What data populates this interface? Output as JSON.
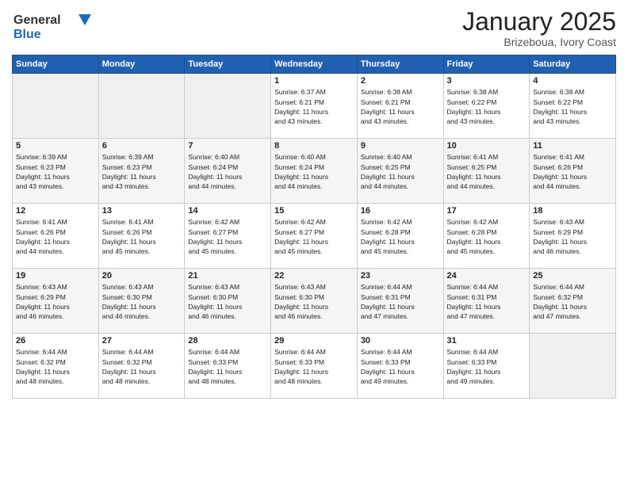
{
  "header": {
    "title": "January 2025",
    "location": "Brizeboua, Ivory Coast"
  },
  "calendar": {
    "days": [
      "Sunday",
      "Monday",
      "Tuesday",
      "Wednesday",
      "Thursday",
      "Friday",
      "Saturday"
    ],
    "weeks": [
      [
        {
          "num": "",
          "info": ""
        },
        {
          "num": "",
          "info": ""
        },
        {
          "num": "",
          "info": ""
        },
        {
          "num": "1",
          "info": "Sunrise: 6:37 AM\nSunset: 6:21 PM\nDaylight: 11 hours\nand 43 minutes."
        },
        {
          "num": "2",
          "info": "Sunrise: 6:38 AM\nSunset: 6:21 PM\nDaylight: 11 hours\nand 43 minutes."
        },
        {
          "num": "3",
          "info": "Sunrise: 6:38 AM\nSunset: 6:22 PM\nDaylight: 11 hours\nand 43 minutes."
        },
        {
          "num": "4",
          "info": "Sunrise: 6:38 AM\nSunset: 6:22 PM\nDaylight: 11 hours\nand 43 minutes."
        }
      ],
      [
        {
          "num": "5",
          "info": "Sunrise: 6:39 AM\nSunset: 6:23 PM\nDaylight: 11 hours\nand 43 minutes."
        },
        {
          "num": "6",
          "info": "Sunrise: 6:39 AM\nSunset: 6:23 PM\nDaylight: 11 hours\nand 43 minutes."
        },
        {
          "num": "7",
          "info": "Sunrise: 6:40 AM\nSunset: 6:24 PM\nDaylight: 11 hours\nand 44 minutes."
        },
        {
          "num": "8",
          "info": "Sunrise: 6:40 AM\nSunset: 6:24 PM\nDaylight: 11 hours\nand 44 minutes."
        },
        {
          "num": "9",
          "info": "Sunrise: 6:40 AM\nSunset: 6:25 PM\nDaylight: 11 hours\nand 44 minutes."
        },
        {
          "num": "10",
          "info": "Sunrise: 6:41 AM\nSunset: 6:25 PM\nDaylight: 11 hours\nand 44 minutes."
        },
        {
          "num": "11",
          "info": "Sunrise: 6:41 AM\nSunset: 6:26 PM\nDaylight: 11 hours\nand 44 minutes."
        }
      ],
      [
        {
          "num": "12",
          "info": "Sunrise: 6:41 AM\nSunset: 6:26 PM\nDaylight: 11 hours\nand 44 minutes."
        },
        {
          "num": "13",
          "info": "Sunrise: 6:41 AM\nSunset: 6:26 PM\nDaylight: 11 hours\nand 45 minutes."
        },
        {
          "num": "14",
          "info": "Sunrise: 6:42 AM\nSunset: 6:27 PM\nDaylight: 11 hours\nand 45 minutes."
        },
        {
          "num": "15",
          "info": "Sunrise: 6:42 AM\nSunset: 6:27 PM\nDaylight: 11 hours\nand 45 minutes."
        },
        {
          "num": "16",
          "info": "Sunrise: 6:42 AM\nSunset: 6:28 PM\nDaylight: 11 hours\nand 45 minutes."
        },
        {
          "num": "17",
          "info": "Sunrise: 6:42 AM\nSunset: 6:28 PM\nDaylight: 11 hours\nand 45 minutes."
        },
        {
          "num": "18",
          "info": "Sunrise: 6:43 AM\nSunset: 6:29 PM\nDaylight: 11 hours\nand 46 minutes."
        }
      ],
      [
        {
          "num": "19",
          "info": "Sunrise: 6:43 AM\nSunset: 6:29 PM\nDaylight: 11 hours\nand 46 minutes."
        },
        {
          "num": "20",
          "info": "Sunrise: 6:43 AM\nSunset: 6:30 PM\nDaylight: 11 hours\nand 46 minutes."
        },
        {
          "num": "21",
          "info": "Sunrise: 6:43 AM\nSunset: 6:30 PM\nDaylight: 11 hours\nand 46 minutes."
        },
        {
          "num": "22",
          "info": "Sunrise: 6:43 AM\nSunset: 6:30 PM\nDaylight: 11 hours\nand 46 minutes."
        },
        {
          "num": "23",
          "info": "Sunrise: 6:44 AM\nSunset: 6:31 PM\nDaylight: 11 hours\nand 47 minutes."
        },
        {
          "num": "24",
          "info": "Sunrise: 6:44 AM\nSunset: 6:31 PM\nDaylight: 11 hours\nand 47 minutes."
        },
        {
          "num": "25",
          "info": "Sunrise: 6:44 AM\nSunset: 6:32 PM\nDaylight: 11 hours\nand 47 minutes."
        }
      ],
      [
        {
          "num": "26",
          "info": "Sunrise: 6:44 AM\nSunset: 6:32 PM\nDaylight: 11 hours\nand 48 minutes."
        },
        {
          "num": "27",
          "info": "Sunrise: 6:44 AM\nSunset: 6:32 PM\nDaylight: 11 hours\nand 48 minutes."
        },
        {
          "num": "28",
          "info": "Sunrise: 6:44 AM\nSunset: 6:33 PM\nDaylight: 11 hours\nand 48 minutes."
        },
        {
          "num": "29",
          "info": "Sunrise: 6:44 AM\nSunset: 6:33 PM\nDaylight: 11 hours\nand 48 minutes."
        },
        {
          "num": "30",
          "info": "Sunrise: 6:44 AM\nSunset: 6:33 PM\nDaylight: 11 hours\nand 49 minutes."
        },
        {
          "num": "31",
          "info": "Sunrise: 6:44 AM\nSunset: 6:33 PM\nDaylight: 11 hours\nand 49 minutes."
        },
        {
          "num": "",
          "info": ""
        }
      ]
    ]
  }
}
